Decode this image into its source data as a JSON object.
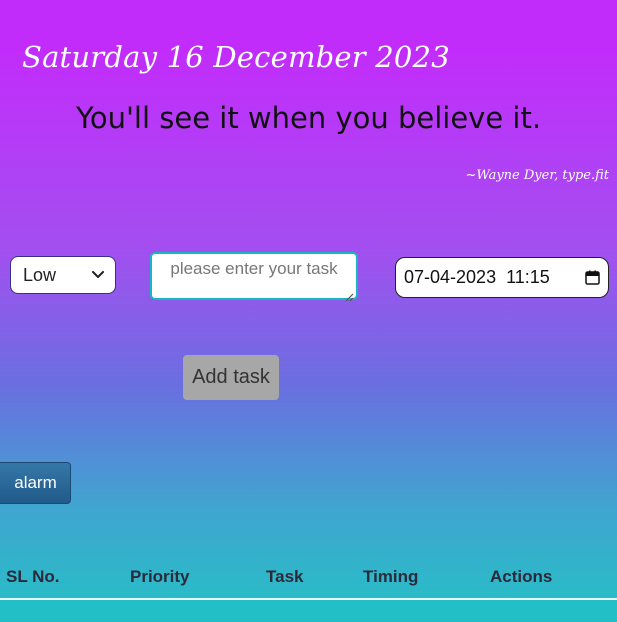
{
  "header": {
    "date": "Saturday 16 December 2023",
    "quote": "You'll see it when you believe it.",
    "author": "~Wayne Dyer, type.fit"
  },
  "form": {
    "priority": {
      "selected": "Low",
      "icon": "chevron-down-icon"
    },
    "task": {
      "placeholder": "please enter your task",
      "value": ""
    },
    "datetime": {
      "value": "07-04-2023  11:15",
      "icon": "calendar-icon"
    },
    "add_label": "Add task"
  },
  "alarm_label": "alarm",
  "table": {
    "columns": [
      "SL No.",
      "Priority",
      "Task",
      "Timing",
      "Actions"
    ]
  },
  "colors": {
    "top": "#c22cfb",
    "bottom": "#25c0c6",
    "input_border": "#18b5c2",
    "add_button": "#a7a7a7",
    "alarm_button": "#205a8a"
  }
}
